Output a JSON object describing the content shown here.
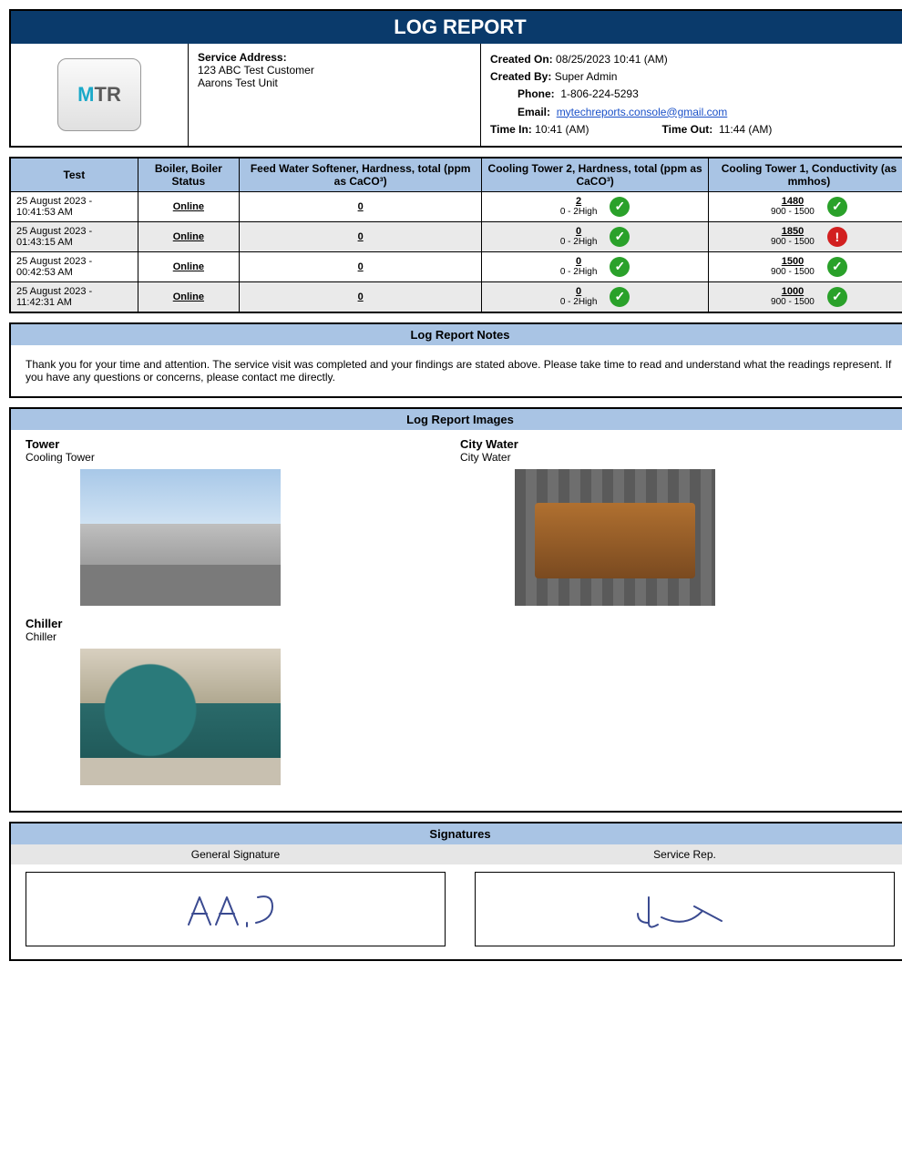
{
  "title": "LOG REPORT",
  "service_address": {
    "label": "Service Address:",
    "line1": "123 ABC Test Customer",
    "line2": "Aarons Test Unit"
  },
  "meta": {
    "created_on_label": "Created On:",
    "created_on": "08/25/2023 10:41 (AM)",
    "created_by_label": "Created By:",
    "created_by": "Super Admin",
    "phone_label": "Phone:",
    "phone": "1-806-224-5293",
    "email_label": "Email:",
    "email": "mytechreports.console@gmail.com",
    "time_in_label": "Time In:",
    "time_in": "10:41 (AM)",
    "time_out_label": "Time Out:",
    "time_out": "11:44 (AM)"
  },
  "table": {
    "headers": [
      "Test",
      "Boiler, Boiler Status",
      "Feed Water Softener, Hardness, total (ppm as CaCO³)",
      "Cooling Tower 2, Hardness, total (ppm as CaCO³)",
      "Cooling Tower 1, Conductivity (as mmhos)"
    ],
    "rows": [
      {
        "test": "25 August 2023 - 10:41:53 AM",
        "boiler": "Online",
        "feed": {
          "value": "0",
          "range": ""
        },
        "ct2": {
          "value": "2",
          "range": "0 - 2High",
          "status": "ok"
        },
        "ct1": {
          "value": "1480",
          "range": "900 - 1500",
          "status": "ok"
        }
      },
      {
        "test": "25 August 2023 - 01:43:15 AM",
        "boiler": "Online",
        "feed": {
          "value": "0",
          "range": ""
        },
        "ct2": {
          "value": "0",
          "range": "0 - 2High",
          "status": "ok"
        },
        "ct1": {
          "value": "1850",
          "range": "900 - 1500",
          "status": "alert"
        }
      },
      {
        "test": "25 August 2023 - 00:42:53 AM",
        "boiler": "Online",
        "feed": {
          "value": "0",
          "range": ""
        },
        "ct2": {
          "value": "0",
          "range": "0 - 2High",
          "status": "ok"
        },
        "ct1": {
          "value": "1500",
          "range": "900 - 1500",
          "status": "ok"
        }
      },
      {
        "test": "25 August 2023 - 11:42:31 AM",
        "boiler": "Online",
        "feed": {
          "value": "0",
          "range": ""
        },
        "ct2": {
          "value": "0",
          "range": "0 - 2High",
          "status": "ok"
        },
        "ct1": {
          "value": "1000",
          "range": "900 - 1500",
          "status": "ok"
        }
      }
    ]
  },
  "notes": {
    "heading": "Log Report Notes",
    "body": "Thank you for your time and attention. The service visit was completed and your findings are stated above. Please take time to read and understand what the readings represent. If you have any questions or concerns, please contact me directly."
  },
  "images": {
    "heading": "Log Report Images",
    "items": [
      {
        "title": "Tower",
        "subtitle": "Cooling Tower",
        "kind": "tower"
      },
      {
        "title": "City Water",
        "subtitle": "City Water",
        "kind": "city"
      },
      {
        "title": "Chiller",
        "subtitle": "Chiller",
        "kind": "chiller"
      }
    ]
  },
  "signatures": {
    "heading": "Signatures",
    "general_label": "General Signature",
    "rep_label": "Service Rep."
  },
  "logo_text": "MTR"
}
